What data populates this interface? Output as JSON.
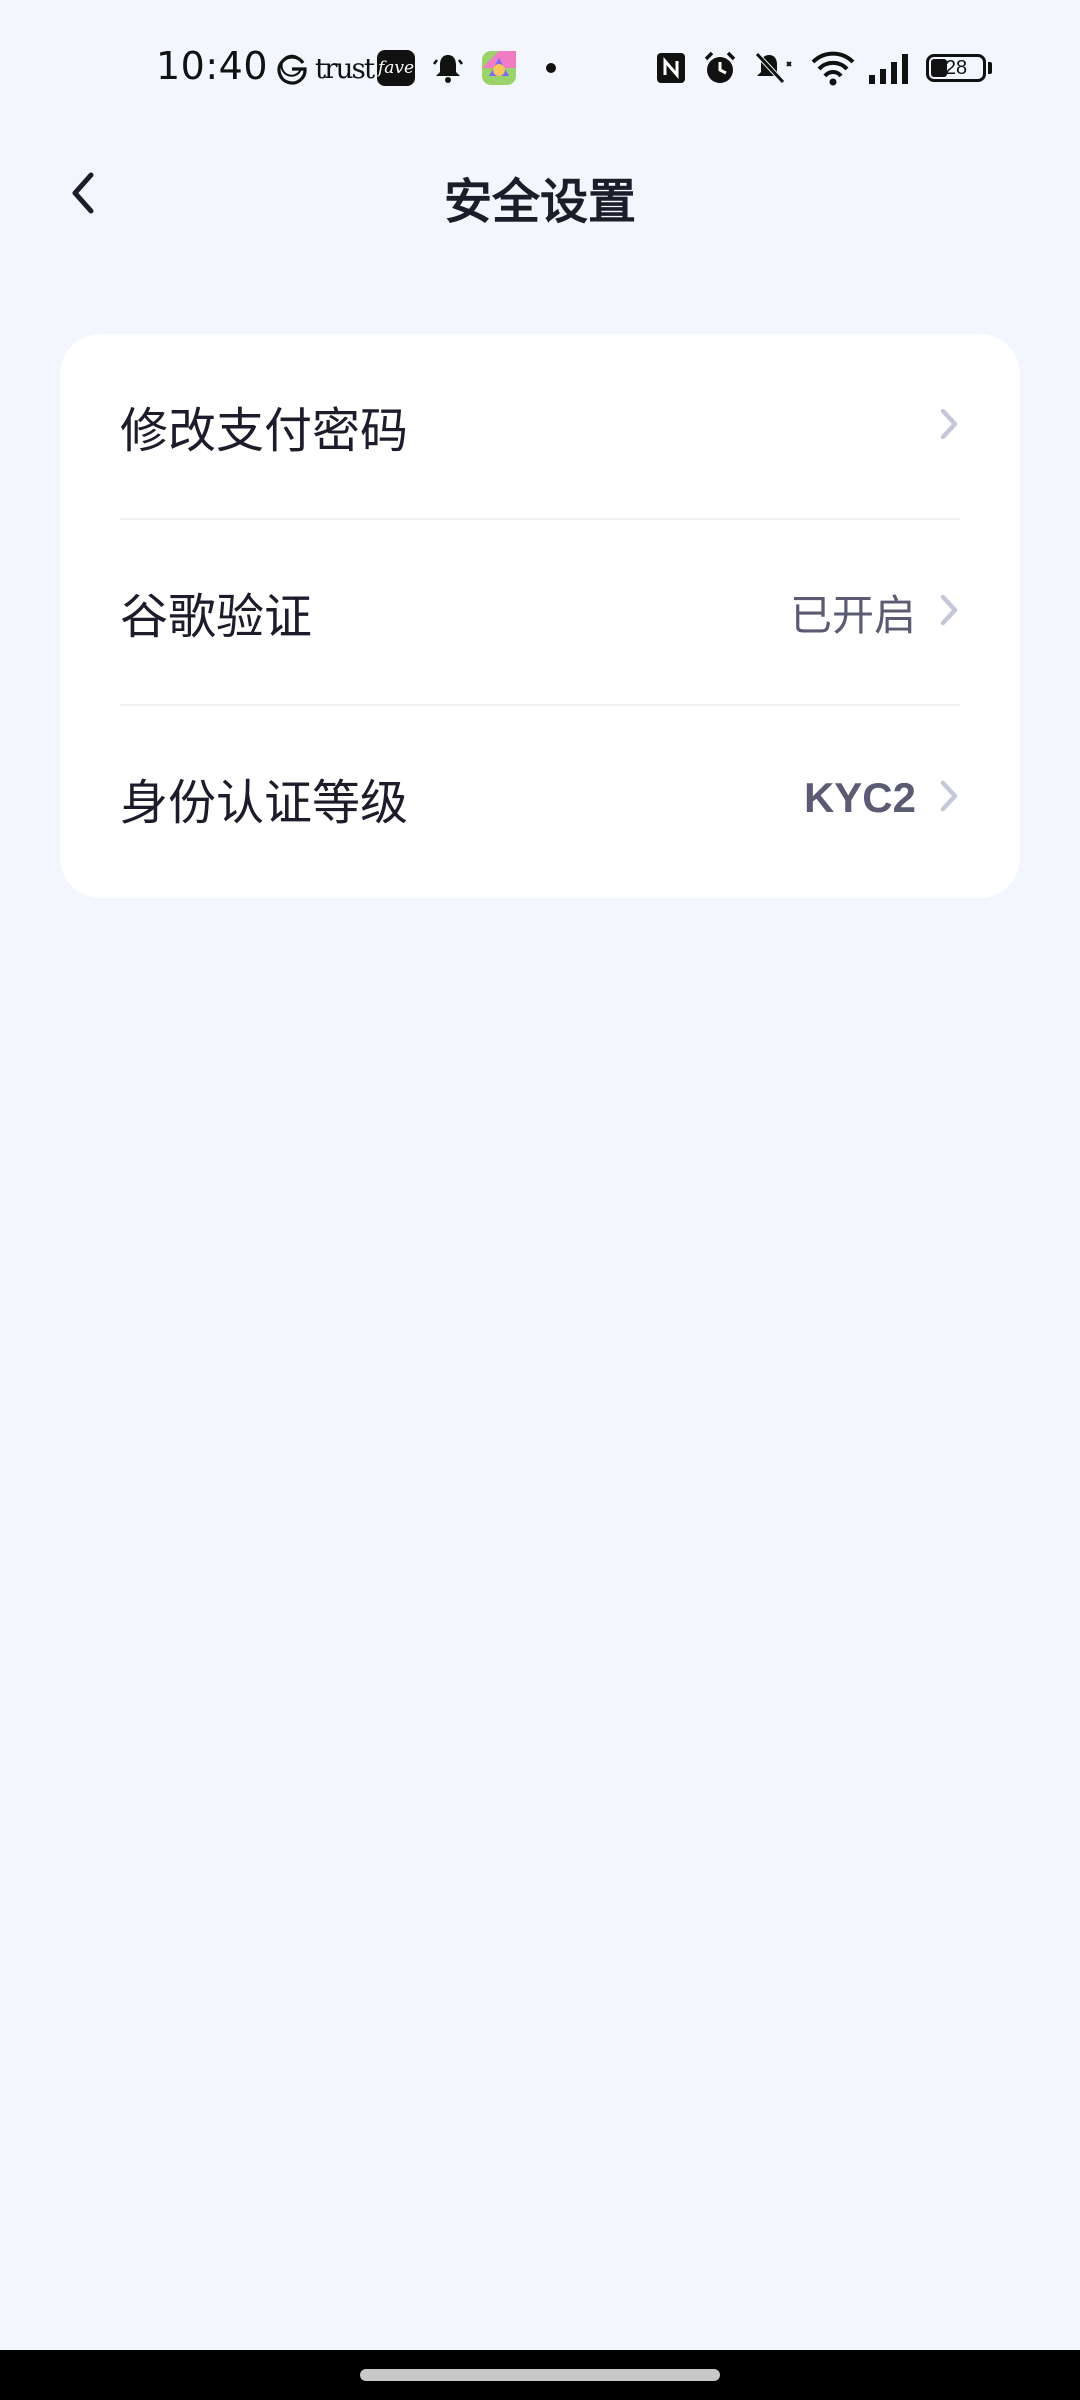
{
  "status_bar": {
    "time": "10:40",
    "notification_icons": [
      "google-icon",
      "trust-app-icon",
      "fave-app-icon",
      "bell-icon",
      "colorful-app-icon",
      "dot-icon"
    ],
    "system_icons": [
      "nfc-icon",
      "alarm-icon",
      "mute-icon",
      "wifi-icon",
      "signal-icon",
      "battery-icon"
    ],
    "trust_label": "trust",
    "fave_label": "fave",
    "battery_level": "28"
  },
  "header": {
    "back_icon": "chevron-left-icon",
    "title": "安全设置"
  },
  "settings": {
    "items": [
      {
        "label": "修改支付密码",
        "value": "",
        "icon": "chevron-right-icon"
      },
      {
        "label": "谷歌验证",
        "value": "已开启",
        "icon": "chevron-right-icon"
      },
      {
        "label": "身份认证等级",
        "value": "KYC2",
        "icon": "chevron-right-icon"
      }
    ]
  },
  "colors": {
    "background": "#f3f6fd",
    "card": "#ffffff",
    "text_primary": "#1c1c2b",
    "text_secondary": "#5b5c73",
    "chevron": "#c5c8d8",
    "divider": "#f0f1f5"
  }
}
